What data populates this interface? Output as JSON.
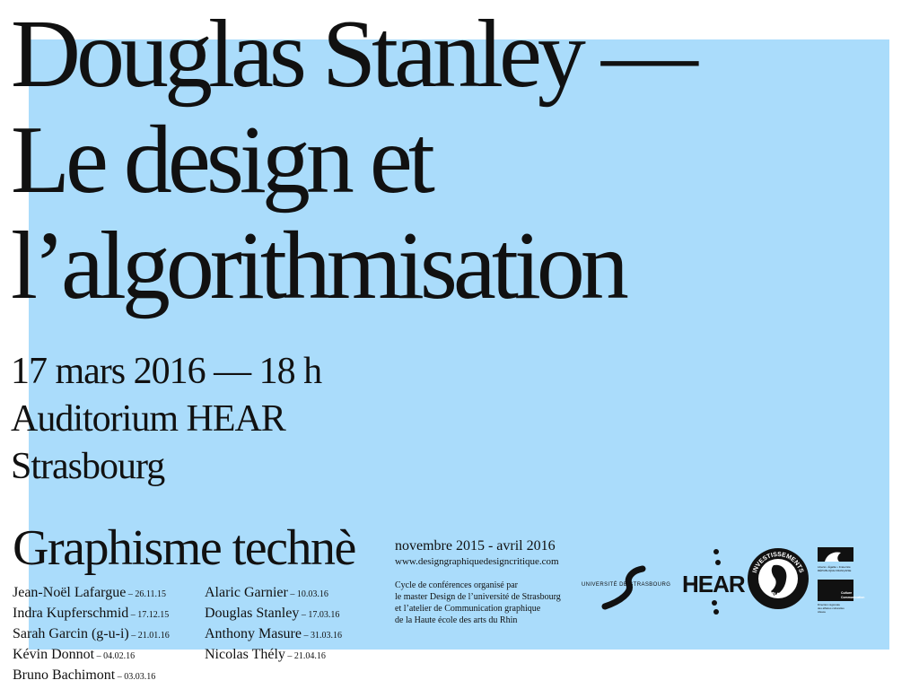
{
  "poster": {
    "title_lines": [
      "Douglas Stanley —",
      "Le design et",
      "l’algorithmisation"
    ],
    "info_lines": [
      "17 mars 2016 — 18 h",
      "Auditorium HEAR",
      "Strasbourg"
    ],
    "series_title": "Graphisme technè",
    "speakers_col1": [
      {
        "name": "Jean-Noël Lafargue",
        "date": " – 26.11.15"
      },
      {
        "name": "Indra Kupferschmid",
        "date": " – 17.12.15"
      },
      {
        "name": "Sarah Garcin (g-u-i)",
        "date": " – 21.01.16"
      },
      {
        "name": "Kévin Donnot",
        "date": " – 04.02.16"
      },
      {
        "name": "Bruno Bachimont",
        "date": " – 03.03.16"
      }
    ],
    "speakers_col2": [
      {
        "name": "Alaric Garnier",
        "date": " – 10.03.16"
      },
      {
        "name": "Douglas Stanley",
        "date": " – 17.03.16"
      },
      {
        "name": "Anthony Masure",
        "date": " – 31.03.16"
      },
      {
        "name": "Nicolas Thély",
        "date": " – 21.04.16"
      }
    ],
    "cycle_dates": "novembre 2015 - avril 2016",
    "website": "www.designgraphiquedesigncritique.com",
    "organizer_lines": [
      "Cycle de conférences organisé par",
      "le master Design de l’université de Strasbourg",
      "et l’atelier de Communication graphique",
      "de la Haute école des arts du Rhin"
    ]
  },
  "logos": {
    "unistra_text": "UNIVERSITÉ DE STRASBOURG",
    "hear_text": "HEAR",
    "ia_text_top": "INVESTISSEMENTS",
    "ia_text_bottom": "D'AVENIR",
    "rf_lines": [
      "Liberté • Égalité • Fraternité",
      "RÉPUBLIQUE FRANÇAISE"
    ],
    "cc_lines": [
      "Culture",
      "Communication"
    ],
    "cc_sub_lines": [
      "Direction régionale",
      "des affaires culturelles",
      "Alsace"
    ]
  },
  "colors": {
    "panel": "#aadcfb",
    "ink": "#111111",
    "background": "#ffffff"
  }
}
